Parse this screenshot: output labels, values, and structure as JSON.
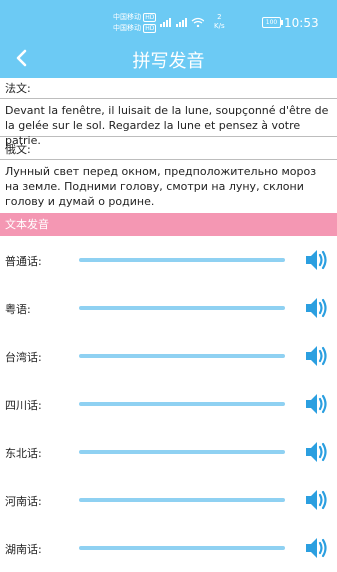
{
  "status": {
    "carrier1": "中国移动",
    "carrier2": "中国移动",
    "hd": "HD",
    "speed_value": "2",
    "speed_unit": "K/s",
    "battery": "100",
    "time": "10:53"
  },
  "nav": {
    "title": "拼写发音"
  },
  "french": {
    "label": "法文:",
    "text": "Devant la fenêtre, il luisait de la lune, soupçonné d'être de la gelée sur le sol. Regardez la lune et pensez à votre patrie."
  },
  "russian": {
    "label": "俄文:",
    "text": "Лунный свет перед окном, предположительно мороз на земле. Подними голову, смотри на луну, склони голову и думай о родине."
  },
  "section_header": "文本发音",
  "dialects": [
    {
      "label": "普通话:"
    },
    {
      "label": "粤语:"
    },
    {
      "label": "台湾话:"
    },
    {
      "label": "四川话:"
    },
    {
      "label": "东北话:"
    },
    {
      "label": "河南话:"
    },
    {
      "label": "湖南话:"
    }
  ],
  "colors": {
    "primary": "#6ccaf4",
    "accent": "#f497b3",
    "track": "#8fd1f2",
    "speaker": "#2b9fe0"
  }
}
